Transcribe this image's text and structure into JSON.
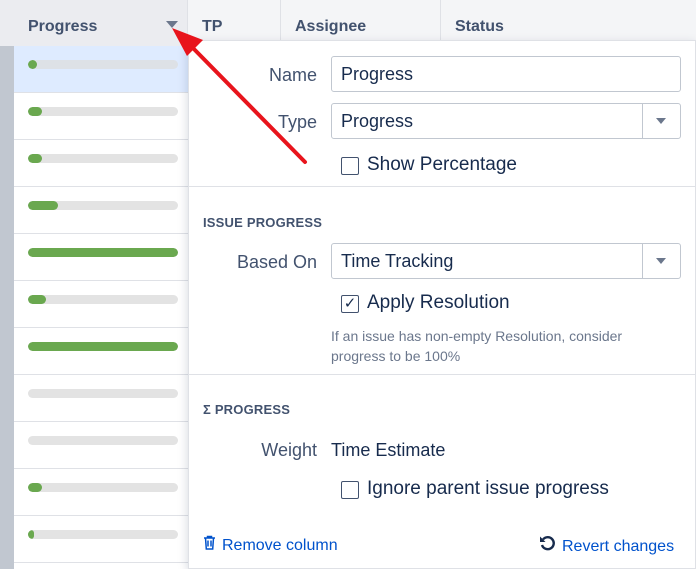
{
  "columns": {
    "progress": "Progress",
    "tp": "TP",
    "assignee": "Assignee",
    "status": "Status"
  },
  "rows": [
    {
      "progress": 0.06,
      "selected": true
    },
    {
      "progress": 0.09
    },
    {
      "progress": 0.09
    },
    {
      "progress": 0.2
    },
    {
      "progress": 1.0
    },
    {
      "progress": 0.12
    },
    {
      "progress": 1.0
    },
    {
      "progress": 0.0
    },
    {
      "progress": 0.0
    },
    {
      "progress": 0.09
    },
    {
      "progress": 0.04
    }
  ],
  "panel": {
    "name_label": "Name",
    "name_value": "Progress",
    "type_label": "Type",
    "type_value": "Progress",
    "show_percentage": "Show Percentage",
    "show_percentage_checked": false,
    "issue_progress_heading": "ISSUE PROGRESS",
    "based_on_label": "Based On",
    "based_on_value": "Time Tracking",
    "apply_resolution": "Apply Resolution",
    "apply_resolution_checked": true,
    "resolution_hint": "If an issue has non-empty Resolution, consider progress to be 100%",
    "sigma_heading": "Σ PROGRESS",
    "weight_label": "Weight",
    "weight_value": "Time Estimate",
    "ignore_parent": "Ignore parent issue progress",
    "ignore_parent_checked": false,
    "remove_column": "Remove column",
    "revert_changes": "Revert changes"
  },
  "colors": {
    "bar_fill": "#6aa84f",
    "bar_track": "#e3e3e3",
    "link": "#0052cc",
    "arrow": "#e8141c"
  },
  "icons": {
    "trash": "trash-icon",
    "undo": "undo-icon",
    "dropdown": "chevron-down-icon"
  }
}
